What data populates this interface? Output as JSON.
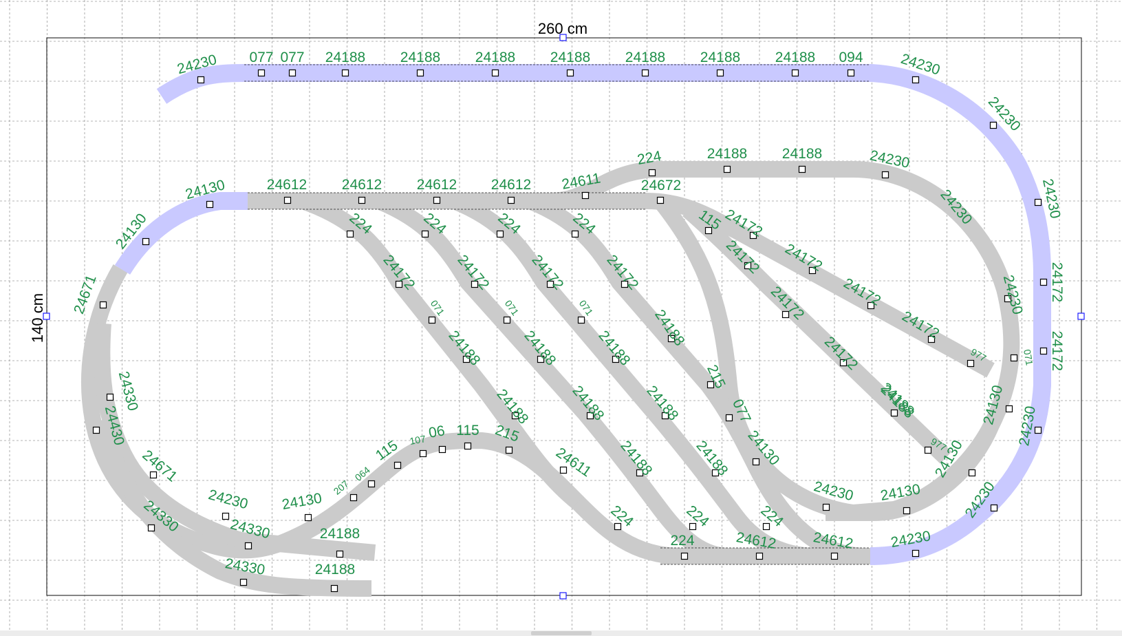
{
  "layout": {
    "width_label": "260 cm",
    "height_label": "140 cm"
  },
  "colors": {
    "grey_track": "#cbcbcb",
    "blue_track": "#c9c9ff",
    "label_green": "#1f8f4a",
    "grid": "#9a9a9a",
    "handle": "#1a1aff"
  },
  "labels": {
    "top_row": [
      "24230",
      "077",
      "077",
      "24188",
      "24188",
      "24188",
      "24188",
      "24188",
      "24188",
      "24188",
      "094",
      "24230"
    ],
    "right_outer": [
      "24230",
      "24230",
      "24172",
      "24172",
      "24230",
      "24230"
    ],
    "upper_line": [
      "24130",
      "24130",
      "24612",
      "24612",
      "24612",
      "24612",
      "24611",
      "224",
      "24188",
      "24188",
      "24230",
      "24672"
    ],
    "diag_224": [
      "224",
      "224",
      "224",
      "224"
    ],
    "diag_24172": [
      "24172",
      "24172",
      "24172",
      "24172"
    ],
    "diag_071": [
      "071",
      "071",
      "071"
    ],
    "diag_24188_a": [
      "24188",
      "24188",
      "24188",
      "24188",
      "24188"
    ],
    "diag_24188_b": [
      "24188",
      "24188",
      "24188",
      "24188",
      "24188"
    ],
    "right_spur": [
      "115",
      "24172",
      "24172",
      "24172",
      "24172",
      "24172",
      "24172",
      "24172",
      "24188",
      "977",
      "977"
    ],
    "right_return": [
      "24230",
      "24230",
      "071",
      "24130",
      "24130",
      "215",
      "077",
      "24130",
      "24230",
      "24130"
    ],
    "left_side": [
      "24671",
      "24330",
      "24430",
      "24671",
      "24330"
    ],
    "bottom_left": [
      "24230",
      "24130",
      "24330",
      "24188",
      "24330",
      "24188"
    ],
    "lower_curve": [
      "207",
      "064",
      "115",
      "107",
      "06",
      "115",
      "215",
      "24611"
    ],
    "bottom_row": [
      "224",
      "224",
      "224",
      "224",
      "24612",
      "24612",
      "24230"
    ]
  }
}
